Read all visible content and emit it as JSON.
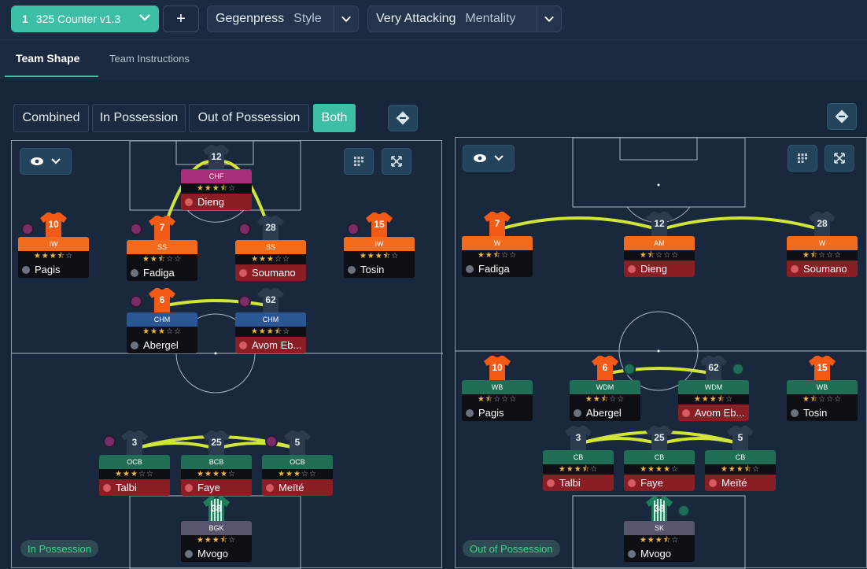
{
  "header": {
    "tactic_number": "1",
    "tactic_name": "325 Counter v1.3",
    "add_label": "+",
    "style_value": "Gegenpress",
    "style_label": "Style",
    "mentality_value": "Very Attacking",
    "mentality_label": "Mentality"
  },
  "tabs": [
    {
      "label": "Team Shape",
      "active": true
    },
    {
      "label": "Team Instructions",
      "active": false
    }
  ],
  "view_modes": [
    {
      "label": "Combined",
      "active": false
    },
    {
      "label": "In Possession",
      "active": false
    },
    {
      "label": "Out of Possession",
      "active": false
    },
    {
      "label": "Both",
      "active": true
    }
  ],
  "colors": {
    "accent": "#3dbfa6",
    "orange_role": "#f26b1d",
    "pink_role": "#a72e7a",
    "blue_role": "#2a5696",
    "green_role": "#1f6e55",
    "gk_role": "#58566f",
    "orange_shirt": "#f25a16",
    "green_shirt": "#1f7d5e",
    "red_name": "#8b1d25",
    "link_line": "#cfe53a"
  },
  "in_possession": {
    "phase_label": "In Possession",
    "players": [
      {
        "number": "12",
        "role": "CHF",
        "rating": 3.5,
        "name": "Dieng",
        "highlight": true,
        "role_color": "pink",
        "shirt": "ghost",
        "trait": false
      },
      {
        "number": "10",
        "role": "IW",
        "rating": 3.5,
        "name": "Pagis",
        "highlight": false,
        "role_color": "orange",
        "shirt": "orange",
        "trait": true
      },
      {
        "number": "7",
        "role": "SS",
        "rating": 2.5,
        "name": "Fadiga",
        "highlight": false,
        "role_color": "orange",
        "shirt": "orange",
        "trait": true
      },
      {
        "number": "28",
        "role": "SS",
        "rating": 3,
        "name": "Soumano",
        "highlight": true,
        "role_color": "orange",
        "shirt": "ghost",
        "trait": true
      },
      {
        "number": "15",
        "role": "IW",
        "rating": 3.5,
        "name": "Tosin",
        "highlight": false,
        "role_color": "orange",
        "shirt": "orange",
        "trait": true
      },
      {
        "number": "6",
        "role": "CHM",
        "rating": 3,
        "name": "Abergel",
        "highlight": false,
        "role_color": "blue",
        "shirt": "orange",
        "trait": true
      },
      {
        "number": "62",
        "role": "CHM",
        "rating": 3.5,
        "name": "Avom Eb...",
        "highlight": true,
        "role_color": "blue",
        "shirt": "ghost",
        "trait": true
      },
      {
        "number": "3",
        "role": "OCB",
        "rating": 3,
        "name": "Talbi",
        "highlight": true,
        "role_color": "green",
        "shirt": "ghost",
        "trait": true
      },
      {
        "number": "25",
        "role": "BCB",
        "rating": 4,
        "name": "Faye",
        "highlight": true,
        "role_color": "green",
        "shirt": "ghost",
        "trait": false
      },
      {
        "number": "5",
        "role": "OCB",
        "rating": 3,
        "name": "Meïté",
        "highlight": true,
        "role_color": "green",
        "shirt": "ghost",
        "trait": true
      },
      {
        "number": "38",
        "role": "BGK",
        "rating": 3.5,
        "name": "Mvogo",
        "highlight": false,
        "role_color": "gk",
        "shirt": "gk",
        "trait": false
      }
    ]
  },
  "out_of_possession": {
    "phase_label": "Out of Possession",
    "players": [
      {
        "number": "7",
        "role": "W",
        "rating": 2.5,
        "name": "Fadiga",
        "highlight": false,
        "role_color": "orange",
        "shirt": "orange",
        "trait": false
      },
      {
        "number": "12",
        "role": "AM",
        "rating": 1.5,
        "name": "Dieng",
        "highlight": true,
        "role_color": "orange",
        "shirt": "ghost",
        "trait": false
      },
      {
        "number": "28",
        "role": "W",
        "rating": 1.5,
        "name": "Soumano",
        "highlight": true,
        "role_color": "orange",
        "shirt": "ghost",
        "trait": false
      },
      {
        "number": "10",
        "role": "WB",
        "rating": 1.5,
        "name": "Pagis",
        "highlight": false,
        "role_color": "green",
        "shirt": "orange",
        "trait": false
      },
      {
        "number": "6",
        "role": "WDM",
        "rating": 2.5,
        "name": "Abergel",
        "highlight": false,
        "role_color": "green",
        "shirt": "orange",
        "trait": true
      },
      {
        "number": "62",
        "role": "WDM",
        "rating": 3.5,
        "name": "Avom Eb...",
        "highlight": true,
        "role_color": "green",
        "shirt": "ghost",
        "trait": true
      },
      {
        "number": "15",
        "role": "WB",
        "rating": 1.5,
        "name": "Tosin",
        "highlight": false,
        "role_color": "green",
        "shirt": "orange",
        "trait": false
      },
      {
        "number": "3",
        "role": "CB",
        "rating": 3.5,
        "name": "Talbi",
        "highlight": true,
        "role_color": "green",
        "shirt": "ghost",
        "trait": false
      },
      {
        "number": "25",
        "role": "CB",
        "rating": 4,
        "name": "Faye",
        "highlight": true,
        "role_color": "green",
        "shirt": "ghost",
        "trait": false
      },
      {
        "number": "5",
        "role": "CB",
        "rating": 3.5,
        "name": "Meïté",
        "highlight": true,
        "role_color": "green",
        "shirt": "ghost",
        "trait": false
      },
      {
        "number": "38",
        "role": "SK",
        "rating": 3.5,
        "name": "Mvogo",
        "highlight": false,
        "role_color": "gk",
        "shirt": "gk",
        "trait": true
      }
    ]
  }
}
